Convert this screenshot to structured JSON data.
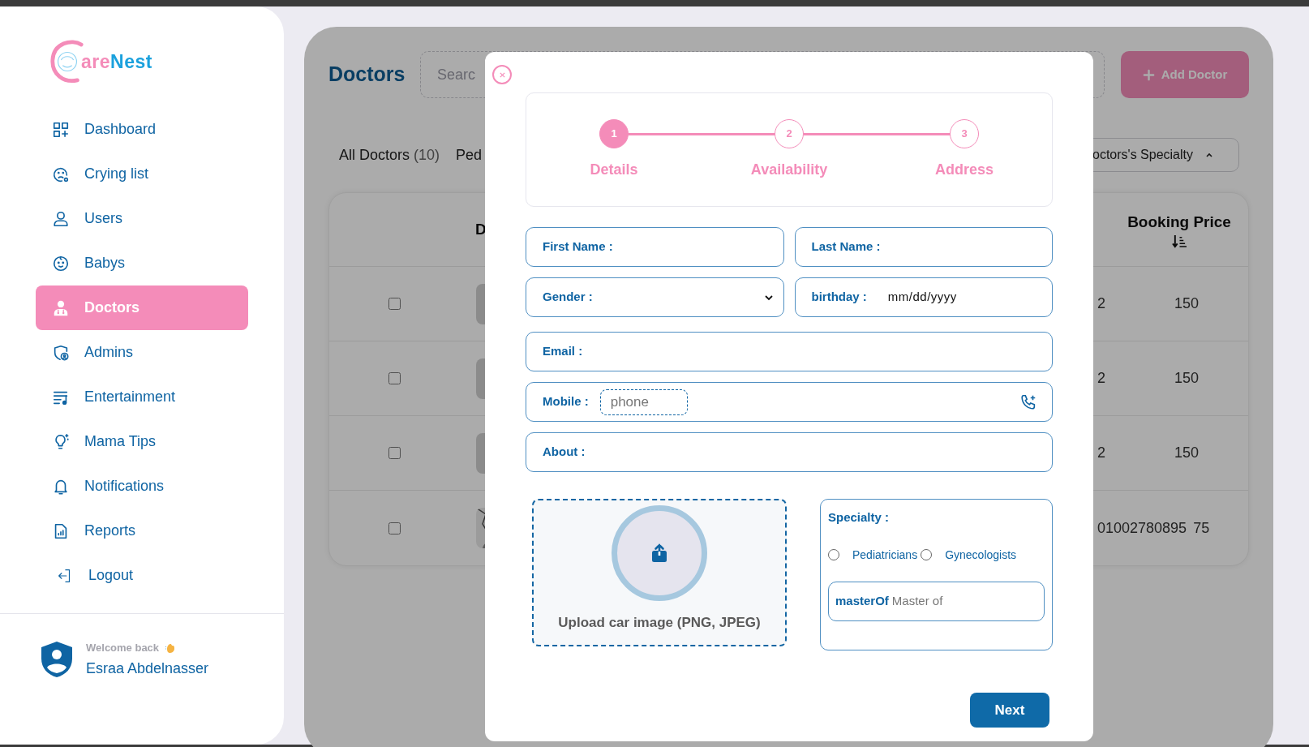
{
  "sidebar": {
    "logo": [
      {
        "text": "are",
        "color": "#f48cb9"
      },
      {
        "text": "Nest",
        "color": "#1ba1dd"
      }
    ],
    "nav": [
      {
        "label": "Dashboard",
        "selected": false
      },
      {
        "label": "Crying list",
        "selected": false
      },
      {
        "label": "Users",
        "selected": false
      },
      {
        "label": "Babys",
        "selected": false
      },
      {
        "label": "Doctors",
        "selected": true
      },
      {
        "label": "Admins",
        "selected": false
      },
      {
        "label": "Entertainment",
        "selected": false
      },
      {
        "label": "Mama Tips",
        "selected": false
      },
      {
        "label": "Notifications",
        "selected": false
      },
      {
        "label": "Reports",
        "selected": false
      },
      {
        "label": "Logout",
        "selected": false
      }
    ],
    "profile": {
      "greeting": "Welcome back",
      "name": "Esraa Abdelnasser"
    }
  },
  "page": {
    "title": "Doctors",
    "search": {
      "placeholder": "Searc"
    },
    "add_button": "Add Doctor",
    "tabs": [
      {
        "label": "All Doctors",
        "count": "(10)"
      },
      {
        "label": "Ped"
      }
    ],
    "specialty_filter": "octors's Specialty",
    "table": {
      "columns": [
        "D",
        "Booking Price"
      ],
      "rows": [
        {
          "kind": "placeholder",
          "checked": false,
          "column_3": "2",
          "price": "150"
        },
        {
          "kind": "placeholder",
          "checked": false,
          "column_3": "2",
          "price": "150"
        },
        {
          "kind": "placeholder",
          "checked": false,
          "column_3": "2",
          "price": "150"
        },
        {
          "kind": "picture",
          "checked": false,
          "phone": "01002780895",
          "price": "75"
        }
      ]
    }
  },
  "modal": {
    "steps": [
      {
        "number": "1",
        "label": "Details",
        "selected": true
      },
      {
        "number": "2",
        "label": "Availability",
        "selected": false
      },
      {
        "number": "3",
        "label": "Address",
        "selected": false
      }
    ],
    "fields": [
      {
        "kind": "text",
        "label": "First Name :"
      },
      {
        "kind": "text",
        "label": "Last Name :"
      },
      {
        "kind": "select",
        "label": "Gender :"
      },
      {
        "kind": "date",
        "label": "birthday :",
        "value": "mm/dd/yyyy"
      },
      {
        "kind": "text",
        "label": "Email :"
      },
      {
        "kind": "phone",
        "label": "Mobile :",
        "placeholder": "phone"
      },
      {
        "kind": "text",
        "label": "About :"
      }
    ],
    "upload": {
      "label": "Upload car image (PNG, JPEG)"
    },
    "specialty": {
      "label": "Specialty :",
      "options": [
        {
          "label": "Pediatricians",
          "selected": false
        },
        {
          "label": "Gynecologists",
          "selected": false
        }
      ],
      "master_of": {
        "label": "masterOf",
        "placeholder": "Master of"
      }
    },
    "next_button": "Next"
  }
}
